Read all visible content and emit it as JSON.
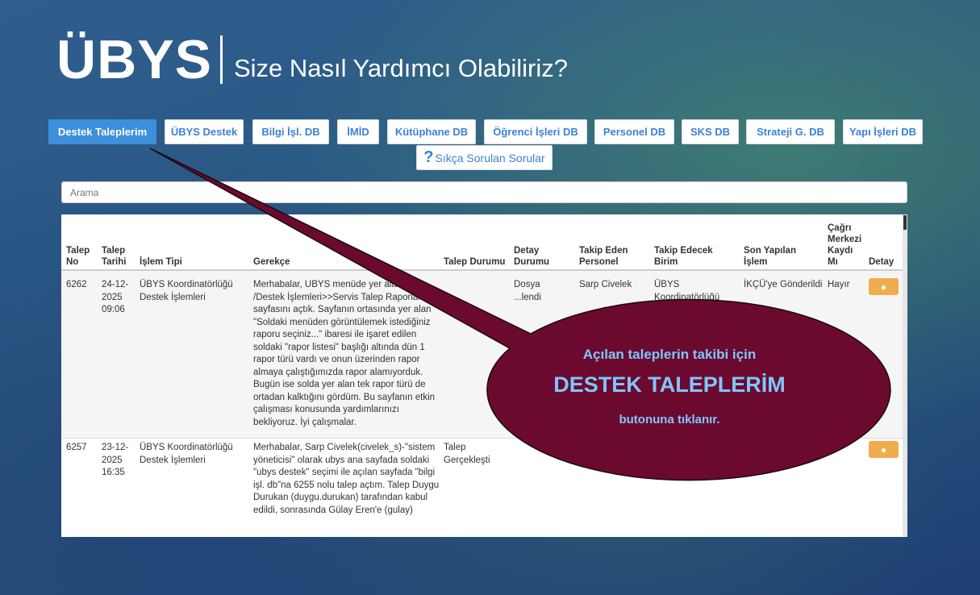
{
  "header": {
    "logo": "ÜBYS",
    "subtitle": "Size Nasıl Yardımcı Olabiliriz?"
  },
  "tabs": [
    {
      "label": "Destek Taleplerim"
    },
    {
      "label": "ÜBYS Destek"
    },
    {
      "label": "Bilgi İşl. DB"
    },
    {
      "label": "İMİD"
    },
    {
      "label": "Kütüphane DB"
    },
    {
      "label": "Öğrenci İşleri DB"
    },
    {
      "label": "Personel DB"
    },
    {
      "label": "SKS DB"
    },
    {
      "label": "Strateji G. DB"
    },
    {
      "label": "Yapı İşleri DB"
    }
  ],
  "faq": {
    "label": "Sıkça Sorulan Sorular",
    "icon": "question-icon"
  },
  "search": {
    "placeholder": "Arama"
  },
  "table": {
    "headers": {
      "talep_no": "Talep No",
      "talep_tarihi": "Talep Tarihi",
      "islem_tipi": "İşlem Tipi",
      "gerekce": "Gerekçe",
      "talep_durumu": "Talep Durumu",
      "detay_durumu": "Detay Durumu",
      "takip_eden": "Takip Eden Personel",
      "takip_edecek": "Takip Edecek Birim",
      "son_islem": "Son Yapılan İşlem",
      "cagri": "Çağrı Merkezi Kaydı Mı",
      "detay": "Detay"
    },
    "rows": [
      {
        "no": "6262",
        "tarih": "24-12-\n2025\n09:06",
        "islem_tipi": "ÜBYS Koordinatörlüğü\nDestek İşlemleri",
        "gerekce": "Merhabalar, UBYS menüde yer alan S...\n/Destek İşlemleri>>Servis Talep Raporları\nsayfasını açtık. Sayfanın ortasında yer alan\n\"Soldaki menüden görüntülemek istediğiniz\nraporu seçiniz...\" ibaresi ile işaret edilen\nsoldaki \"rapor listesi\" başlığı altında dün 1\nrapor türü vardı ve onun üzerinden rapor\nalmaya çalıştığımızda rapor alamıyorduk.\nBugün ise solda yer alan tek rapor türü de\nortadan kalktığını gördüm. Bu sayfanın etkin\nçalışması konusunda yardımlarınızı\nbekliyoruz. İyi çalışmalar.",
        "talep_durumu": "",
        "detay_durumu": "Dosya\n...lendi",
        "takip_eden": "Sarp Civelek",
        "takip_edecek": "ÜBYS\nKoordinatörlüğü",
        "son_islem": "İKÇÜ'ye Gönderildi",
        "cagri": "Hayır",
        "detay_icon": "eye-icon"
      },
      {
        "no": "6257",
        "tarih": "23-12-\n2025\n16:35",
        "islem_tipi": "ÜBYS Koordinatörlüğü\nDestek İşlemleri",
        "gerekce": "Merhabalar, Sarp Civelek(civelek_s)-\"sistem\nyöneticisi\" olarak ubys ana sayfada soldaki\n\"ubys destek\" seçimi ile açılan sayfada \"bilgi\nişl. db\"na 6255 nolu talep açtım. Talep Duygu\nDurukan (duygu.durukan) tarafından kabul\nedildi, sonrasında Gülay Eren'e (gulay)",
        "talep_durumu": "Talep\nGerçekleşti",
        "detay_durumu": "",
        "takip_eden": "",
        "takip_edecek": "",
        "son_islem": "",
        "cagri": "",
        "detay_icon": "eye-icon"
      }
    ]
  },
  "callout": {
    "line1": "Açılan taleplerin takibi için",
    "line2": "DESTEK TALEPLERİM",
    "line3": "butonuna tıklanır.",
    "fill_color": "#6b0a2e"
  }
}
